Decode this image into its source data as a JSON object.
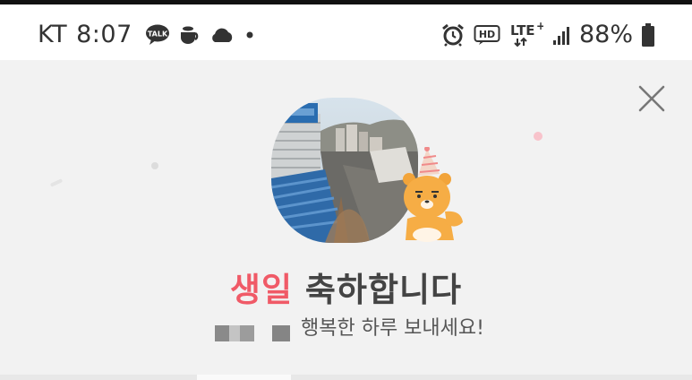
{
  "status_bar": {
    "carrier": "KT",
    "time": "8:07",
    "talk_badge": "TALK",
    "hd_badge": "HD",
    "network": "LTE",
    "network_plus": "+",
    "battery_percent": "88%"
  },
  "card": {
    "title_accent": "생일",
    "title_rest": " 축하합니다",
    "subtitle": "행복한 하루 보내세요!"
  },
  "colors": {
    "accent": "#f05a67",
    "card_background": "#f2f2f2",
    "text": "#444444"
  }
}
